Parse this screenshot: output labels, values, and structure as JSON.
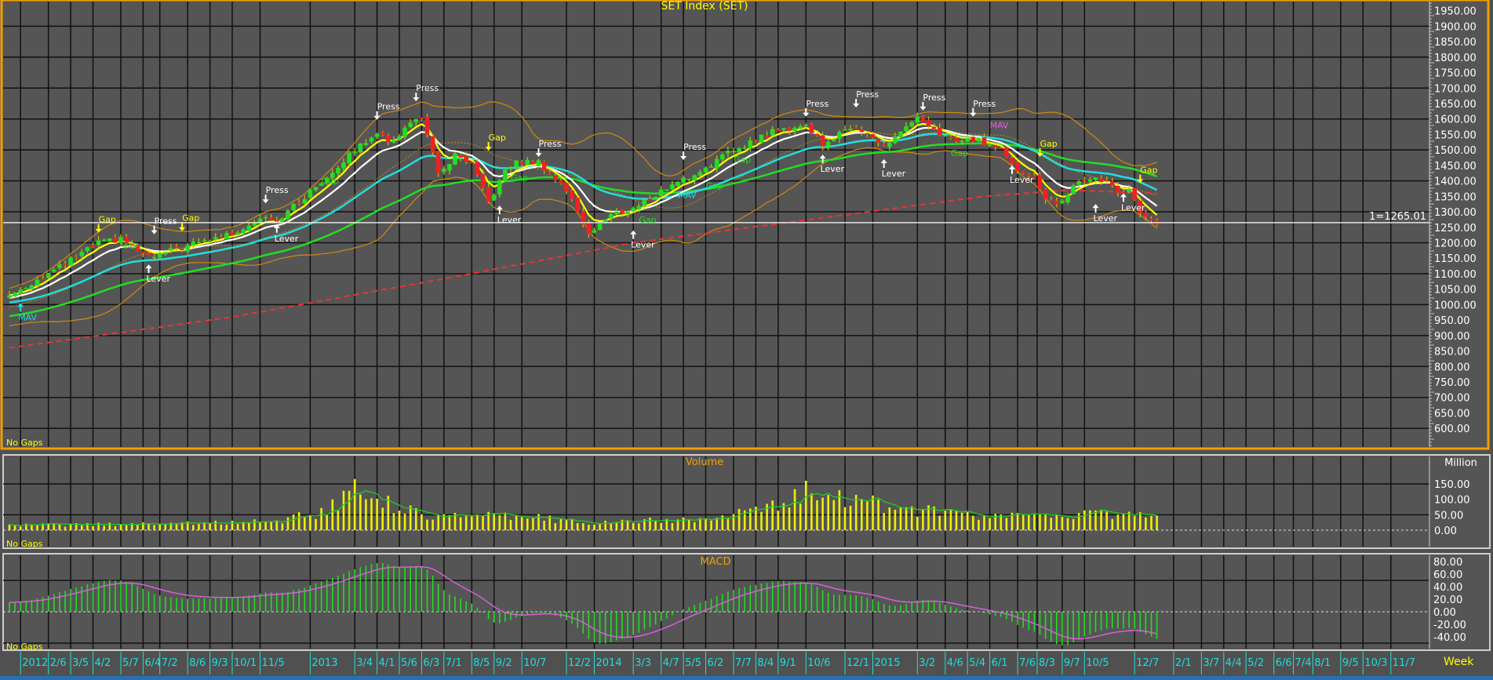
{
  "panels": {
    "main": {
      "title": "SET Index (SET)",
      "no_gaps": "No Gaps",
      "ref_line_label": "1=1265.01",
      "ref_value": 1265.01
    },
    "volume": {
      "title": "Volume",
      "no_gaps": "No Gaps",
      "unit": "Million"
    },
    "macd": {
      "title": "MACD",
      "no_gaps": "No Gaps"
    }
  },
  "axis": {
    "period_label": "Week"
  },
  "colors": {
    "bg": "#555555",
    "grid": "#111111",
    "up": "#22dd22",
    "down": "#ee2222",
    "ema_fast": "#ffff00",
    "ema_mid": "#ffffff",
    "ema_slow": "#22dddd",
    "ema_long": "#22dd22",
    "ma_200": "#ee3333",
    "bands": "#d08a10",
    "volume": "#f0f000",
    "macd_hist": "#22dd22",
    "macd_signal": "#e060e0",
    "date_labels": "#22dddd",
    "frame": "#f0a000"
  },
  "chart_data": {
    "type": "candlestick",
    "title": "SET Index (SET)",
    "interval": "Week",
    "price_ticks": [
      "1950.00",
      "1900.00",
      "1850.00",
      "1800.00",
      "1750.00",
      "1700.00",
      "1650.00",
      "1600.00",
      "1550.00",
      "1500.00",
      "1450.00",
      "1400.00",
      "1350.00",
      "1300.00",
      "1250.00",
      "1200.00",
      "1150.00",
      "1100.00",
      "1050.00",
      "1000.00",
      "950.00",
      "900.00",
      "850.00",
      "800.00",
      "750.00",
      "700.00",
      "650.00",
      "600.00"
    ],
    "price_range": [
      600,
      1950
    ],
    "volume_ticks": [
      "150.00",
      "100.00",
      "50.00",
      "0.00"
    ],
    "macd_ticks": [
      "80.00",
      "60.00",
      "40.00",
      "20.00",
      "0.00",
      "-20.00",
      "-40.00"
    ],
    "date_labels": [
      {
        "t": "2012",
        "w": 2
      },
      {
        "t": "2/6",
        "w": 7
      },
      {
        "t": "3/5",
        "w": 11
      },
      {
        "t": "4/2",
        "w": 15
      },
      {
        "t": "5/7",
        "w": 20
      },
      {
        "t": "6/4",
        "w": 24
      },
      {
        "t": "7/2",
        "w": 27
      },
      {
        "t": "8/6",
        "w": 32
      },
      {
        "t": "9/3",
        "w": 36
      },
      {
        "t": "10/1",
        "w": 40
      },
      {
        "t": "11/5",
        "w": 45
      },
      {
        "t": "2013",
        "w": 54
      },
      {
        "t": "3/4",
        "w": 62
      },
      {
        "t": "4/1",
        "w": 66
      },
      {
        "t": "5/6",
        "w": 70
      },
      {
        "t": "6/3",
        "w": 74
      },
      {
        "t": "7/1",
        "w": 78
      },
      {
        "t": "8/5",
        "w": 83
      },
      {
        "t": "9/2",
        "w": 87
      },
      {
        "t": "10/7",
        "w": 92
      },
      {
        "t": "12/2",
        "w": 100
      },
      {
        "t": "2014",
        "w": 105
      },
      {
        "t": "3/3",
        "w": 112
      },
      {
        "t": "4/7",
        "w": 117
      },
      {
        "t": "5/5",
        "w": 121
      },
      {
        "t": "6/2",
        "w": 125
      },
      {
        "t": "7/7",
        "w": 130
      },
      {
        "t": "8/4",
        "w": 134
      },
      {
        "t": "9/1",
        "w": 138
      },
      {
        "t": "10/6",
        "w": 143
      },
      {
        "t": "12/1",
        "w": 150
      },
      {
        "t": "2015",
        "w": 155
      },
      {
        "t": "3/2",
        "w": 163
      },
      {
        "t": "4/6",
        "w": 168
      },
      {
        "t": "5/4",
        "w": 172
      },
      {
        "t": "6/1",
        "w": 176
      },
      {
        "t": "7/6",
        "w": 181
      },
      {
        "t": "8/3",
        "w": 184.5
      },
      {
        "t": "9/7",
        "w": 189
      },
      {
        "t": "10/5",
        "w": 193
      },
      {
        "t": "12/7",
        "w": 202
      },
      {
        "t": "2/1",
        "w": 209
      },
      {
        "t": "3/7",
        "w": 214
      },
      {
        "t": "4/4",
        "w": 218
      },
      {
        "t": "5/2",
        "w": 222
      },
      {
        "t": "6/6",
        "w": 227
      },
      {
        "t": "7/4",
        "w": 230.5
      },
      {
        "t": "8/1",
        "w": 234
      },
      {
        "t": "9/5",
        "w": 239
      },
      {
        "t": "10/3",
        "w": 243
      },
      {
        "t": "11/7",
        "w": 248
      }
    ],
    "bars": 207,
    "close_anchors": [
      [
        0,
        1030
      ],
      [
        8,
        1110
      ],
      [
        16,
        1200
      ],
      [
        20,
        1210
      ],
      [
        25,
        1150
      ],
      [
        30,
        1180
      ],
      [
        40,
        1230
      ],
      [
        46,
        1290
      ],
      [
        48,
        1270
      ],
      [
        55,
        1380
      ],
      [
        62,
        1500
      ],
      [
        66,
        1560
      ],
      [
        68,
        1520
      ],
      [
        73,
        1600
      ],
      [
        74,
        1610
      ],
      [
        77,
        1420
      ],
      [
        80,
        1480
      ],
      [
        83,
        1450
      ],
      [
        86,
        1330
      ],
      [
        89,
        1430
      ],
      [
        91,
        1460
      ],
      [
        95,
        1460
      ],
      [
        100,
        1370
      ],
      [
        104,
        1230
      ],
      [
        108,
        1290
      ],
      [
        112,
        1310
      ],
      [
        120,
        1400
      ],
      [
        122,
        1410
      ],
      [
        130,
        1500
      ],
      [
        137,
        1560
      ],
      [
        143,
        1580
      ],
      [
        146,
        1520
      ],
      [
        150,
        1560
      ],
      [
        152,
        1580
      ],
      [
        157,
        1510
      ],
      [
        160,
        1560
      ],
      [
        163,
        1600
      ],
      [
        166,
        1560
      ],
      [
        170,
        1530
      ],
      [
        174,
        1530
      ],
      [
        178,
        1500
      ],
      [
        181,
        1440
      ],
      [
        184,
        1410
      ],
      [
        186,
        1340
      ],
      [
        188,
        1320
      ],
      [
        191,
        1380
      ],
      [
        194,
        1410
      ],
      [
        197,
        1400
      ],
      [
        199,
        1360
      ],
      [
        201,
        1370
      ],
      [
        203,
        1300
      ],
      [
        205,
        1270
      ],
      [
        206,
        1265
      ]
    ],
    "ma_long_anchors": [
      [
        0,
        860
      ],
      [
        40,
        960
      ],
      [
        80,
        1090
      ],
      [
        112,
        1200
      ],
      [
        150,
        1290
      ],
      [
        175,
        1350
      ],
      [
        190,
        1370
      ],
      [
        206,
        1360
      ]
    ],
    "volume_anchors_million": [
      [
        0,
        15
      ],
      [
        20,
        20
      ],
      [
        40,
        25
      ],
      [
        50,
        35
      ],
      [
        56,
        60
      ],
      [
        60,
        100
      ],
      [
        63,
        170
      ],
      [
        64,
        110
      ],
      [
        68,
        90
      ],
      [
        72,
        60
      ],
      [
        76,
        50
      ],
      [
        85,
        45
      ],
      [
        95,
        40
      ],
      [
        105,
        25
      ],
      [
        115,
        30
      ],
      [
        125,
        35
      ],
      [
        133,
        60
      ],
      [
        140,
        90
      ],
      [
        146,
        160
      ],
      [
        150,
        100
      ],
      [
        160,
        70
      ],
      [
        170,
        50
      ],
      [
        175,
        40
      ],
      [
        190,
        55
      ],
      [
        206,
        45
      ]
    ],
    "volume_range": [
      0,
      190
    ],
    "macd_range": [
      -50,
      90
    ],
    "annotations": [
      {
        "t": "MAV",
        "w": 2,
        "p": 1000,
        "dir": "up",
        "c": "#22dddd"
      },
      {
        "t": "Gap",
        "w": 16,
        "p": 1235,
        "dir": "down",
        "c": "#ffff00"
      },
      {
        "t": "Gap",
        "w": 20,
        "p": 1185,
        "dir": "none",
        "c": "#22dd22"
      },
      {
        "t": "Lever",
        "w": 25,
        "p": 1125,
        "dir": "up",
        "c": "#ffffff"
      },
      {
        "t": "Press",
        "w": 26,
        "p": 1230,
        "dir": "down",
        "c": "#ffffff"
      },
      {
        "t": "Gap",
        "w": 31,
        "p": 1240,
        "dir": "down",
        "c": "#ffff00"
      },
      {
        "t": "Press",
        "w": 46,
        "p": 1330,
        "dir": "down",
        "c": "#ffffff"
      },
      {
        "t": "Lever",
        "w": 48,
        "p": 1255,
        "dir": "up",
        "c": "#ffffff"
      },
      {
        "t": "Gap",
        "w": 56,
        "p": 1390,
        "dir": "none",
        "c": "#22dd22"
      },
      {
        "t": "Press",
        "w": 66,
        "p": 1600,
        "dir": "down",
        "c": "#ffffff"
      },
      {
        "t": "Press",
        "w": 73,
        "p": 1660,
        "dir": "down",
        "c": "#ffffff"
      },
      {
        "t": "Gap",
        "w": 86,
        "p": 1500,
        "dir": "down",
        "c": "#ffff00"
      },
      {
        "t": "Gap",
        "w": 90,
        "p": 1400,
        "dir": "none",
        "c": "#22dd22"
      },
      {
        "t": "Lever",
        "w": 88,
        "p": 1315,
        "dir": "up",
        "c": "#ffffff"
      },
      {
        "t": "Press",
        "w": 95,
        "p": 1480,
        "dir": "down",
        "c": "#ffffff"
      },
      {
        "t": "Gap",
        "w": 113,
        "p": 1265,
        "dir": "none",
        "c": "#22dd22"
      },
      {
        "t": "Lever",
        "w": 112,
        "p": 1235,
        "dir": "up",
        "c": "#ffffff"
      },
      {
        "t": "MAV",
        "w": 120,
        "p": 1345,
        "dir": "none",
        "c": "#22dddd"
      },
      {
        "t": "Press",
        "w": 121,
        "p": 1470,
        "dir": "down",
        "c": "#ffffff"
      },
      {
        "t": "Gap",
        "w": 125,
        "p": 1375,
        "dir": "none",
        "c": "#22dd22"
      },
      {
        "t": "Gap",
        "w": 130,
        "p": 1460,
        "dir": "none",
        "c": "#22dd22"
      },
      {
        "t": "Press",
        "w": 143,
        "p": 1610,
        "dir": "down",
        "c": "#ffffff"
      },
      {
        "t": "Lever",
        "w": 146,
        "p": 1480,
        "dir": "up",
        "c": "#ffffff"
      },
      {
        "t": "Press",
        "w": 152,
        "p": 1640,
        "dir": "down",
        "c": "#ffffff"
      },
      {
        "t": "Lever",
        "w": 157,
        "p": 1465,
        "dir": "up",
        "c": "#ffffff"
      },
      {
        "t": "Press",
        "w": 164,
        "p": 1630,
        "dir": "down",
        "c": "#ffffff"
      },
      {
        "t": "Gap",
        "w": 169,
        "p": 1480,
        "dir": "none",
        "c": "#22dd22"
      },
      {
        "t": "Press",
        "w": 173,
        "p": 1610,
        "dir": "down",
        "c": "#ffffff"
      },
      {
        "t": "MAV",
        "w": 176,
        "p": 1570,
        "dir": "none",
        "c": "#e060e0"
      },
      {
        "t": "Lever",
        "w": 180,
        "p": 1445,
        "dir": "up",
        "c": "#ffffff"
      },
      {
        "t": "Gap",
        "w": 185,
        "p": 1480,
        "dir": "down",
        "c": "#ffff00"
      },
      {
        "t": "Lever",
        "w": 195,
        "p": 1320,
        "dir": "up",
        "c": "#ffffff"
      },
      {
        "t": "Lever",
        "w": 200,
        "p": 1355,
        "dir": "up",
        "c": "#ffffff"
      },
      {
        "t": "Gap",
        "w": 203,
        "p": 1395,
        "dir": "down",
        "c": "#ffff00"
      }
    ]
  }
}
